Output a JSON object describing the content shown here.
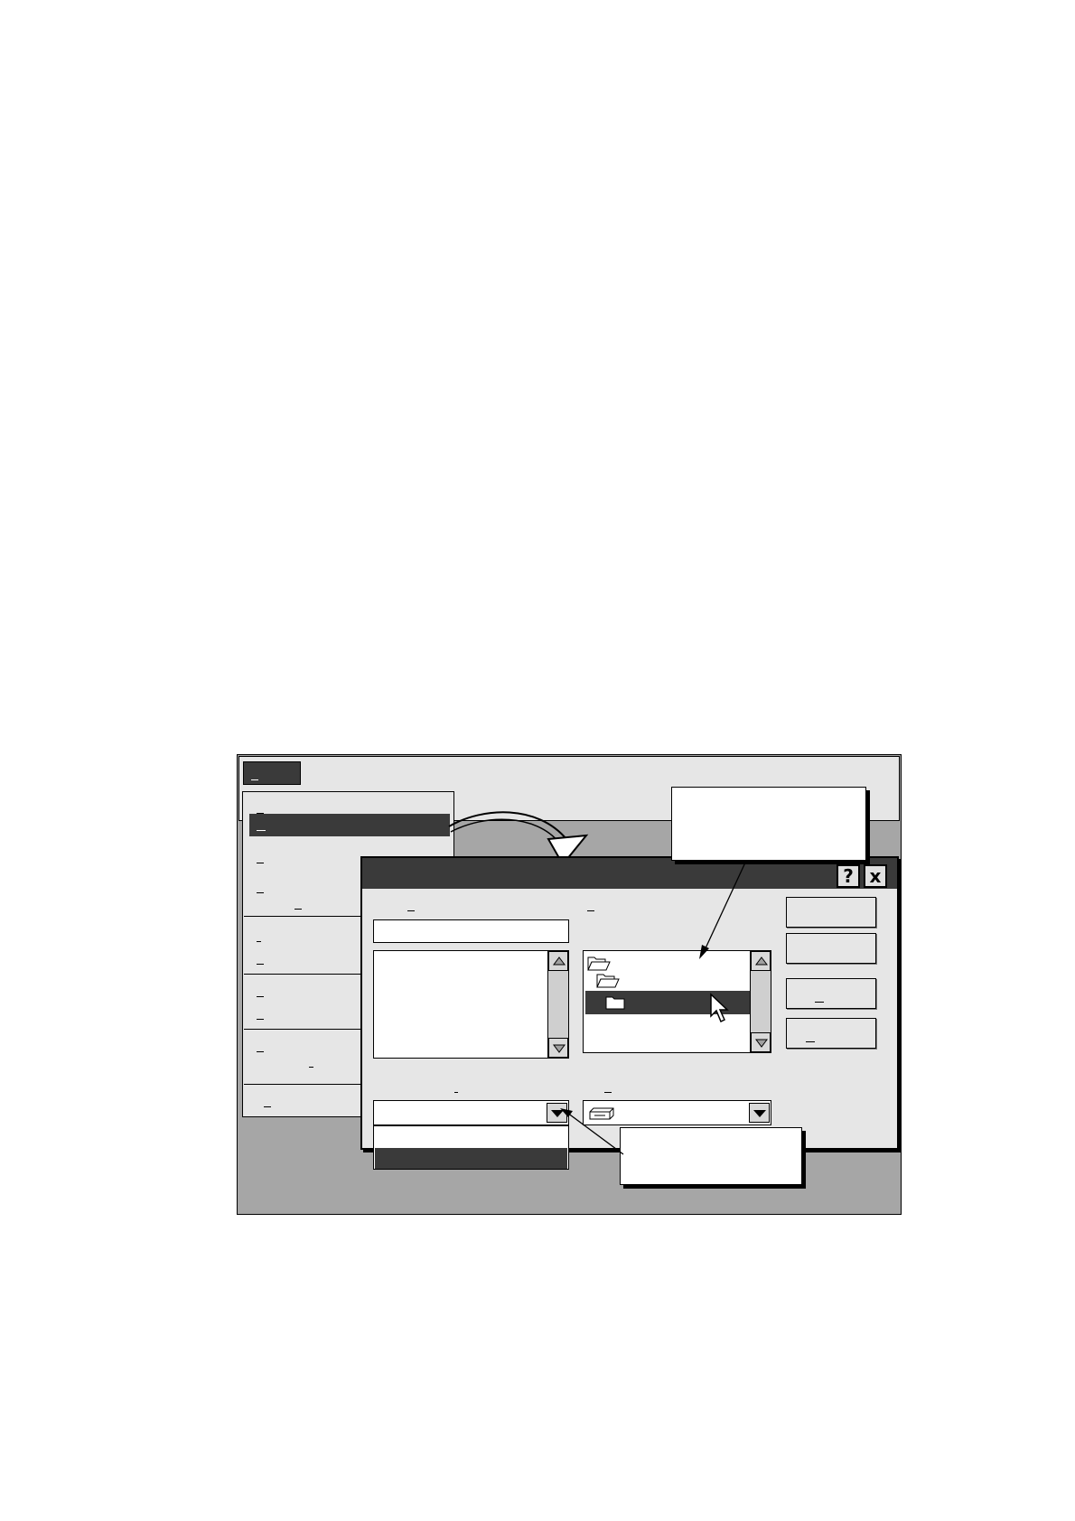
{
  "window": {
    "menu": {
      "label": ""
    }
  },
  "file_menu": {
    "items": [
      {
        "label": "",
        "selected": false
      },
      {
        "label": "",
        "selected": true
      },
      {
        "label": "",
        "selected": false
      },
      {
        "label": "",
        "selected": false
      },
      {
        "label": "",
        "selected": false
      },
      {
        "label": "",
        "selected": false
      },
      {
        "label": "",
        "selected": false
      },
      {
        "label": "",
        "selected": false
      },
      {
        "label": "",
        "selected": false
      },
      {
        "label": "",
        "selected": false
      }
    ]
  },
  "dialog": {
    "title": "",
    "help_icon": "question-mark-icon",
    "close_icon": "close-icon",
    "file_name_label": "",
    "file_name_value": "",
    "folders_label": "",
    "file_types_label": "",
    "drives_label": "",
    "file_types_value": "",
    "drive_value": "",
    "buttons": [
      "",
      "",
      "",
      ""
    ],
    "folder_tree": [
      {
        "label": "",
        "icon": "open-folder-icon"
      },
      {
        "label": "",
        "icon": "open-folder-icon"
      },
      {
        "label": "",
        "icon": "closed-folder-icon",
        "selected": true
      }
    ],
    "file_types_options": [
      {
        "label": "",
        "selected": false
      },
      {
        "label": "",
        "selected": true
      }
    ]
  },
  "callouts": {
    "folder_callout": "",
    "file_type_callout": ""
  },
  "colors": {
    "highlight": "#3a3a3a",
    "face": "#e6e6e6",
    "desktop": "#a6a6a6"
  }
}
